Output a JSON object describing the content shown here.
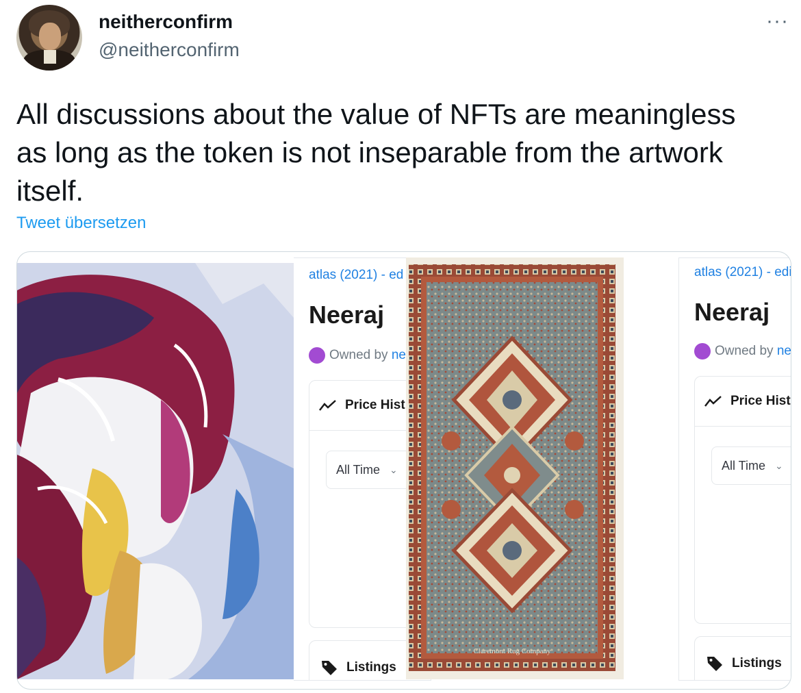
{
  "tweet": {
    "display_name": "neitherconfirm",
    "handle": "@neitherconfirm",
    "more_label": "···",
    "text": "All discussions about the value of NFTs are meaningless as long as the token is not inseparable from the artwork itself.",
    "translate_label": "Tweet übersetzen"
  },
  "media": {
    "panel_left": {
      "breadcrumb": "atlas (2021) - ed",
      "title": "Neeraj",
      "owned_prefix": "Owned by",
      "owner_fragment": "ne",
      "price_history_label": "Price Hist",
      "time_filter": "All Time",
      "listings_label": "Listings"
    },
    "panel_right": {
      "breadcrumb": "atlas (2021) - edi",
      "title": "Neeraj",
      "owned_prefix": "Owned by",
      "owner_fragment": "ne",
      "price_history_label": "Price Hist",
      "time_filter": "All Time",
      "listings_label": "Listings"
    },
    "rug_caption": "Claremont Rug Company"
  },
  "colors": {
    "link": "#1d9bf0",
    "secondary_text": "#536471",
    "opensea_blue": "#2081e2",
    "owner_dot": "#a24bd2",
    "rug_field": "#7d8a8c",
    "rug_border": "#9a4a36"
  },
  "icons": {
    "more": "more-icon",
    "price_history": "trend-line-icon",
    "listings": "tag-icon",
    "dropdown": "chevron-down-icon"
  }
}
